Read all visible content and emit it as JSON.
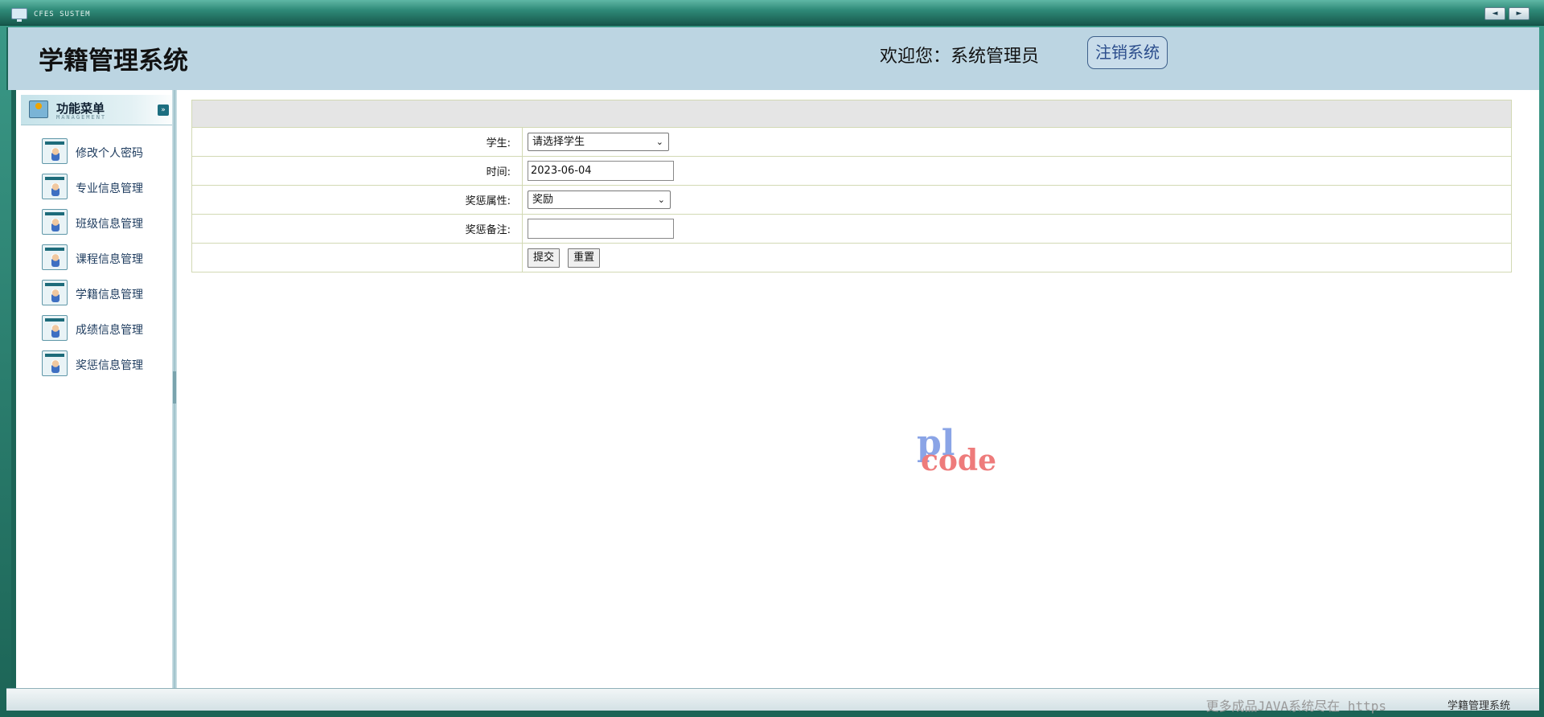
{
  "window": {
    "system_title": "CFES SUSTEM",
    "prev_label": "◄",
    "next_label": "►"
  },
  "header": {
    "app_title": "学籍管理系统",
    "welcome": "欢迎您：系统管理员",
    "logout_label": "注销系统"
  },
  "sidebar": {
    "title": "功能菜单",
    "subtitle": "MANAGEMENT",
    "items": [
      {
        "label": "修改个人密码"
      },
      {
        "label": "专业信息管理"
      },
      {
        "label": "班级信息管理"
      },
      {
        "label": "课程信息管理"
      },
      {
        "label": "学籍信息管理"
      },
      {
        "label": "成绩信息管理"
      },
      {
        "label": "奖惩信息管理"
      }
    ]
  },
  "form": {
    "student_label": "学生:",
    "student_selected": "请选择学生",
    "time_label": "时间:",
    "time_value": "2023-06-04",
    "type_label": "奖惩属性:",
    "type_selected": "奖励",
    "note_label": "奖惩备注:",
    "note_value": "",
    "submit_label": "提交",
    "reset_label": "重置"
  },
  "watermark": {
    "logo_top": "pl",
    "logo_bottom": "code"
  },
  "footer": {
    "promo": "更多成品JAVA系统尽在 https",
    "app_name": "学籍管理系统"
  }
}
